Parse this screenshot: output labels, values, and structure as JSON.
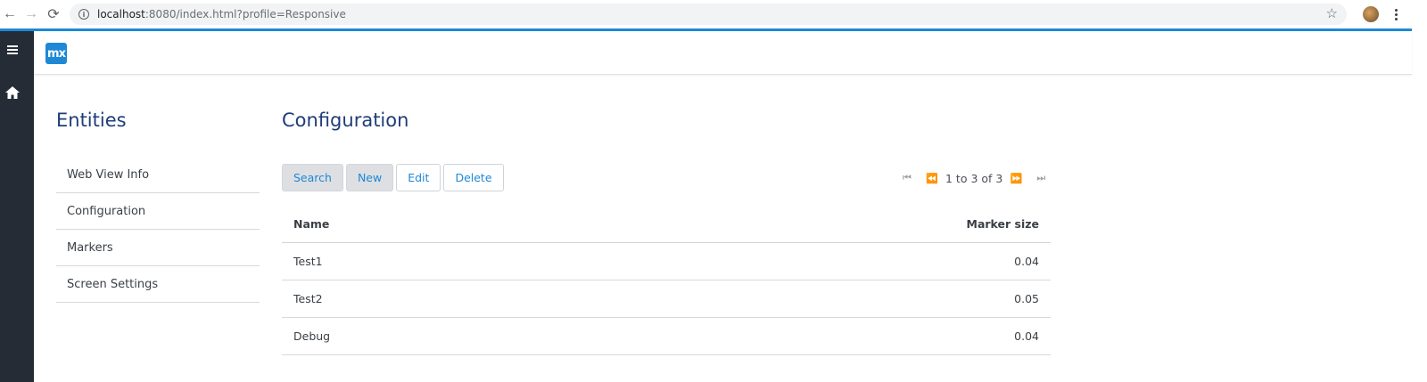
{
  "browser": {
    "url_host": "localhost",
    "url_rest": ":8080/index.html?profile=Responsive",
    "back_icon": "←",
    "forward_icon": "→",
    "reload_icon": "⟳",
    "star_icon": "☆",
    "info_icon": "i"
  },
  "colors": {
    "accent": "#1e88d6",
    "sidebar": "#252c36",
    "title": "#1f3d7a"
  },
  "app": {
    "logo_text": "mx"
  },
  "entities": {
    "title": "Entities",
    "items": [
      {
        "label": "Web View Info"
      },
      {
        "label": "Configuration"
      },
      {
        "label": "Markers"
      },
      {
        "label": "Screen Settings"
      }
    ]
  },
  "main": {
    "title": "Configuration",
    "toolbar": {
      "search": "Search",
      "new": "New",
      "edit": "Edit",
      "delete": "Delete"
    },
    "pager": {
      "text": "1 to 3 of 3",
      "first_icon": "⏮",
      "prev_icon": "⏪",
      "next_icon": "⏩",
      "last_icon": "⏭"
    },
    "grid": {
      "headers": {
        "name": "Name",
        "marker": "Marker size"
      },
      "rows": [
        {
          "name": "Test1",
          "marker": "0.04"
        },
        {
          "name": "Test2",
          "marker": "0.05"
        },
        {
          "name": "Debug",
          "marker": "0.04"
        }
      ]
    }
  }
}
